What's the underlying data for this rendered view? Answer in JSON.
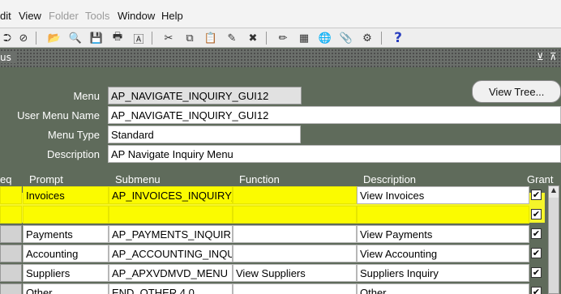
{
  "menubar": {
    "items": [
      {
        "label": "dit",
        "enabled": true
      },
      {
        "label": "View",
        "enabled": true
      },
      {
        "label": "Folder",
        "enabled": false
      },
      {
        "label": "Tools",
        "enabled": false
      },
      {
        "label": "Window",
        "enabled": true
      },
      {
        "label": "Help",
        "enabled": true
      }
    ]
  },
  "toolbar": {
    "icons": [
      "navigator-icon",
      "refresh-icon",
      "folder-open-icon",
      "find-icon",
      "save-icon",
      "print-icon",
      "translate-icon",
      "cut-icon",
      "copy-icon",
      "paste-icon",
      "new-record-icon",
      "delete-record-icon",
      "edit-icon",
      "attachment-icon",
      "world-icon",
      "clip-icon",
      "zoom-icon",
      "help-icon"
    ],
    "glyphs": [
      "⮊",
      "⊘",
      "📂",
      "🔍",
      "💾",
      "🖶",
      "🄰",
      "✂",
      "⧉",
      "📋",
      "✎",
      "✖",
      "✏",
      "▦",
      "🌐",
      "📎",
      "⚙",
      "?"
    ]
  },
  "window": {
    "title": "us",
    "controls": [
      "⊻",
      "⊼"
    ]
  },
  "header": {
    "menu": {
      "label": "Menu",
      "value": "AP_NAVIGATE_INQUIRY_GUI12"
    },
    "user_menu_name": {
      "label": "User Menu Name",
      "value": "AP_NAVIGATE_INQUIRY_GUI12"
    },
    "menu_type": {
      "label": "Menu Type",
      "value": "Standard"
    },
    "description": {
      "label": "Description",
      "value": "AP Navigate Inquiry Menu"
    },
    "view_tree_button": "View Tree..."
  },
  "table": {
    "columns": [
      "eq",
      "Prompt",
      "Submenu",
      "Function",
      "Description",
      "Grant"
    ],
    "rows": [
      {
        "prompt": "Invoices",
        "submenu": "AP_INVOICES_INQUIRY_",
        "function": "",
        "description": "View Invoices",
        "grant": true,
        "highlight": true
      },
      {
        "prompt": "",
        "submenu": "",
        "function": "",
        "description": "",
        "grant": true,
        "highlight": true
      },
      {
        "prompt": "Payments",
        "submenu": "AP_PAYMENTS_INQUIR",
        "function": "",
        "description": "View Payments",
        "grant": true,
        "highlight": false
      },
      {
        "prompt": "Accounting",
        "submenu": "AP_ACCOUNTING_INQU",
        "function": "",
        "description": "View Accounting",
        "grant": true,
        "highlight": false
      },
      {
        "prompt": "Suppliers",
        "submenu": "AP_APXVDMVD_MENU",
        "function": "View Suppliers",
        "description": "Suppliers Inquiry",
        "grant": true,
        "highlight": false
      },
      {
        "prompt": "Other",
        "submenu": "END_OTHER 4.0",
        "function": "",
        "description": "Other",
        "grant": true,
        "highlight": false
      }
    ]
  },
  "colors": {
    "form_bg": "#5f6b5b",
    "highlight": "#fbfb00"
  }
}
